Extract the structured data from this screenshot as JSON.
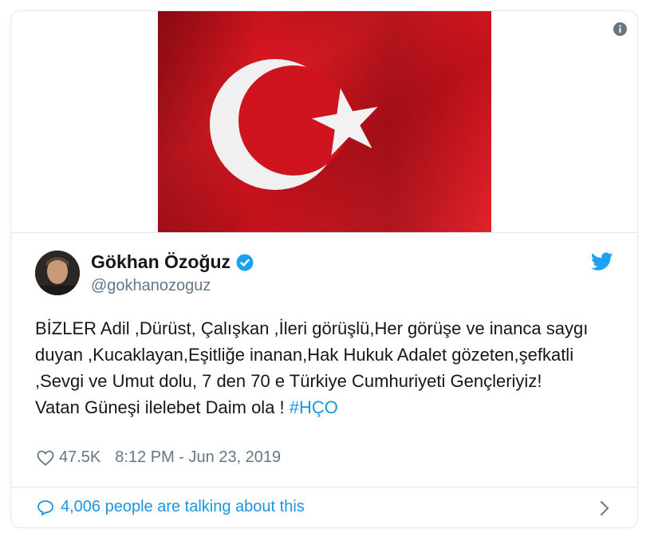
{
  "media": {
    "alt": "Turkish flag",
    "flag_red": "#d0141f",
    "crescent_color": "#f2f2f2"
  },
  "tweet": {
    "author_name": "Gökhan Özoğuz",
    "author_handle": "@gokhanozoguz",
    "verified": true,
    "text_line1": "BİZLER  Adil ,Dürüst, Çalışkan ,İleri görüşlü,Her görüşe ve inanca saygı duyan ,Kucaklayan,Eşitliğe inanan,Hak Hukuk Adalet gözeten,şefkatli ,Sevgi ve Umut dolu, 7 den 70 e Türkiye Cumhuriyeti Gençleriyiz!",
    "text_line2_prefix": "Vatan Güneşi ilelebet Daim ola ! ",
    "hashtag": "#HÇO",
    "likes": "47.5K",
    "timestamp": "8:12 PM - Jun 23, 2019"
  },
  "footer": {
    "talking_text": "4,006 people are talking about this"
  },
  "icons": {
    "info": "info-icon",
    "verified": "verified-badge-icon",
    "logo": "twitter-bird-icon",
    "like": "heart-icon",
    "reply": "speech-bubble-icon",
    "more": "chevron-right-icon"
  },
  "colors": {
    "link": "#1b95e0",
    "secondary_text": "#657786",
    "border": "#e1e8ed"
  }
}
